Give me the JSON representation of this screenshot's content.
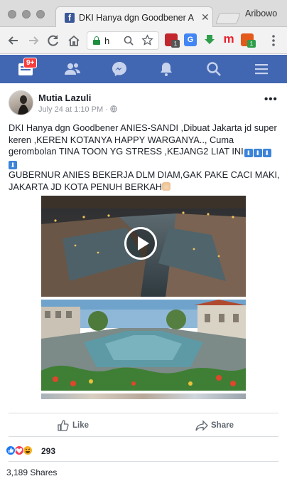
{
  "browser": {
    "tab_title": "DKI Hanya dgn Goodbener ANIES-SANDI",
    "tab_close": "✕",
    "profile_name": "Aribowo",
    "url": "h",
    "favicon_letter": "f",
    "extensions": [
      {
        "name": "ublock-icon",
        "color": "#c1272d",
        "badge": "1",
        "badge_color": "#555"
      },
      {
        "name": "google-translate-icon",
        "color": "#4285f4",
        "badge": "",
        "badge_color": ""
      },
      {
        "name": "download-icon",
        "color": "#2e9e4b",
        "badge": "",
        "badge_color": ""
      },
      {
        "name": "m-extension-icon",
        "color": "#e8212e",
        "badge": "",
        "badge_color": ""
      },
      {
        "name": "office-icon",
        "color": "#e35a1a",
        "badge": "1",
        "badge_color": "#2e9e4b"
      }
    ]
  },
  "fb_nav": {
    "notification_badge": "9+",
    "color": "#4267b2"
  },
  "post": {
    "author": "Mutia Lazuli",
    "timestamp": "July 24 at 1:10 PM",
    "meta_separator": " · ",
    "more_label": "•••",
    "message_lines": [
      "DKI Hanya dgn Goodbener ANIES-SANDI ,Dibuat Jakarta jd super",
      "keren ,KEREN KOTANYA HAPPY WARGANYA.., Cuma",
      "gerombolan TINA TOON YG STRESS ,KEJANG2 LIAT INI",
      "",
      "GUBERNUR ANIES BEKERJA DLM DIAM,GAK PAKE CACI MAKI,",
      "JAKARTA JD KOTA PENUH BERKAH"
    ],
    "arrow_emoji": "⬇",
    "like_label": "Like",
    "share_label": "Share",
    "reaction_count": "293",
    "shares_text": "3,189 Shares"
  },
  "colors": {
    "like_blue": "#1877f2",
    "love_red": "#f33e58",
    "haha_yellow": "#f7b125"
  }
}
